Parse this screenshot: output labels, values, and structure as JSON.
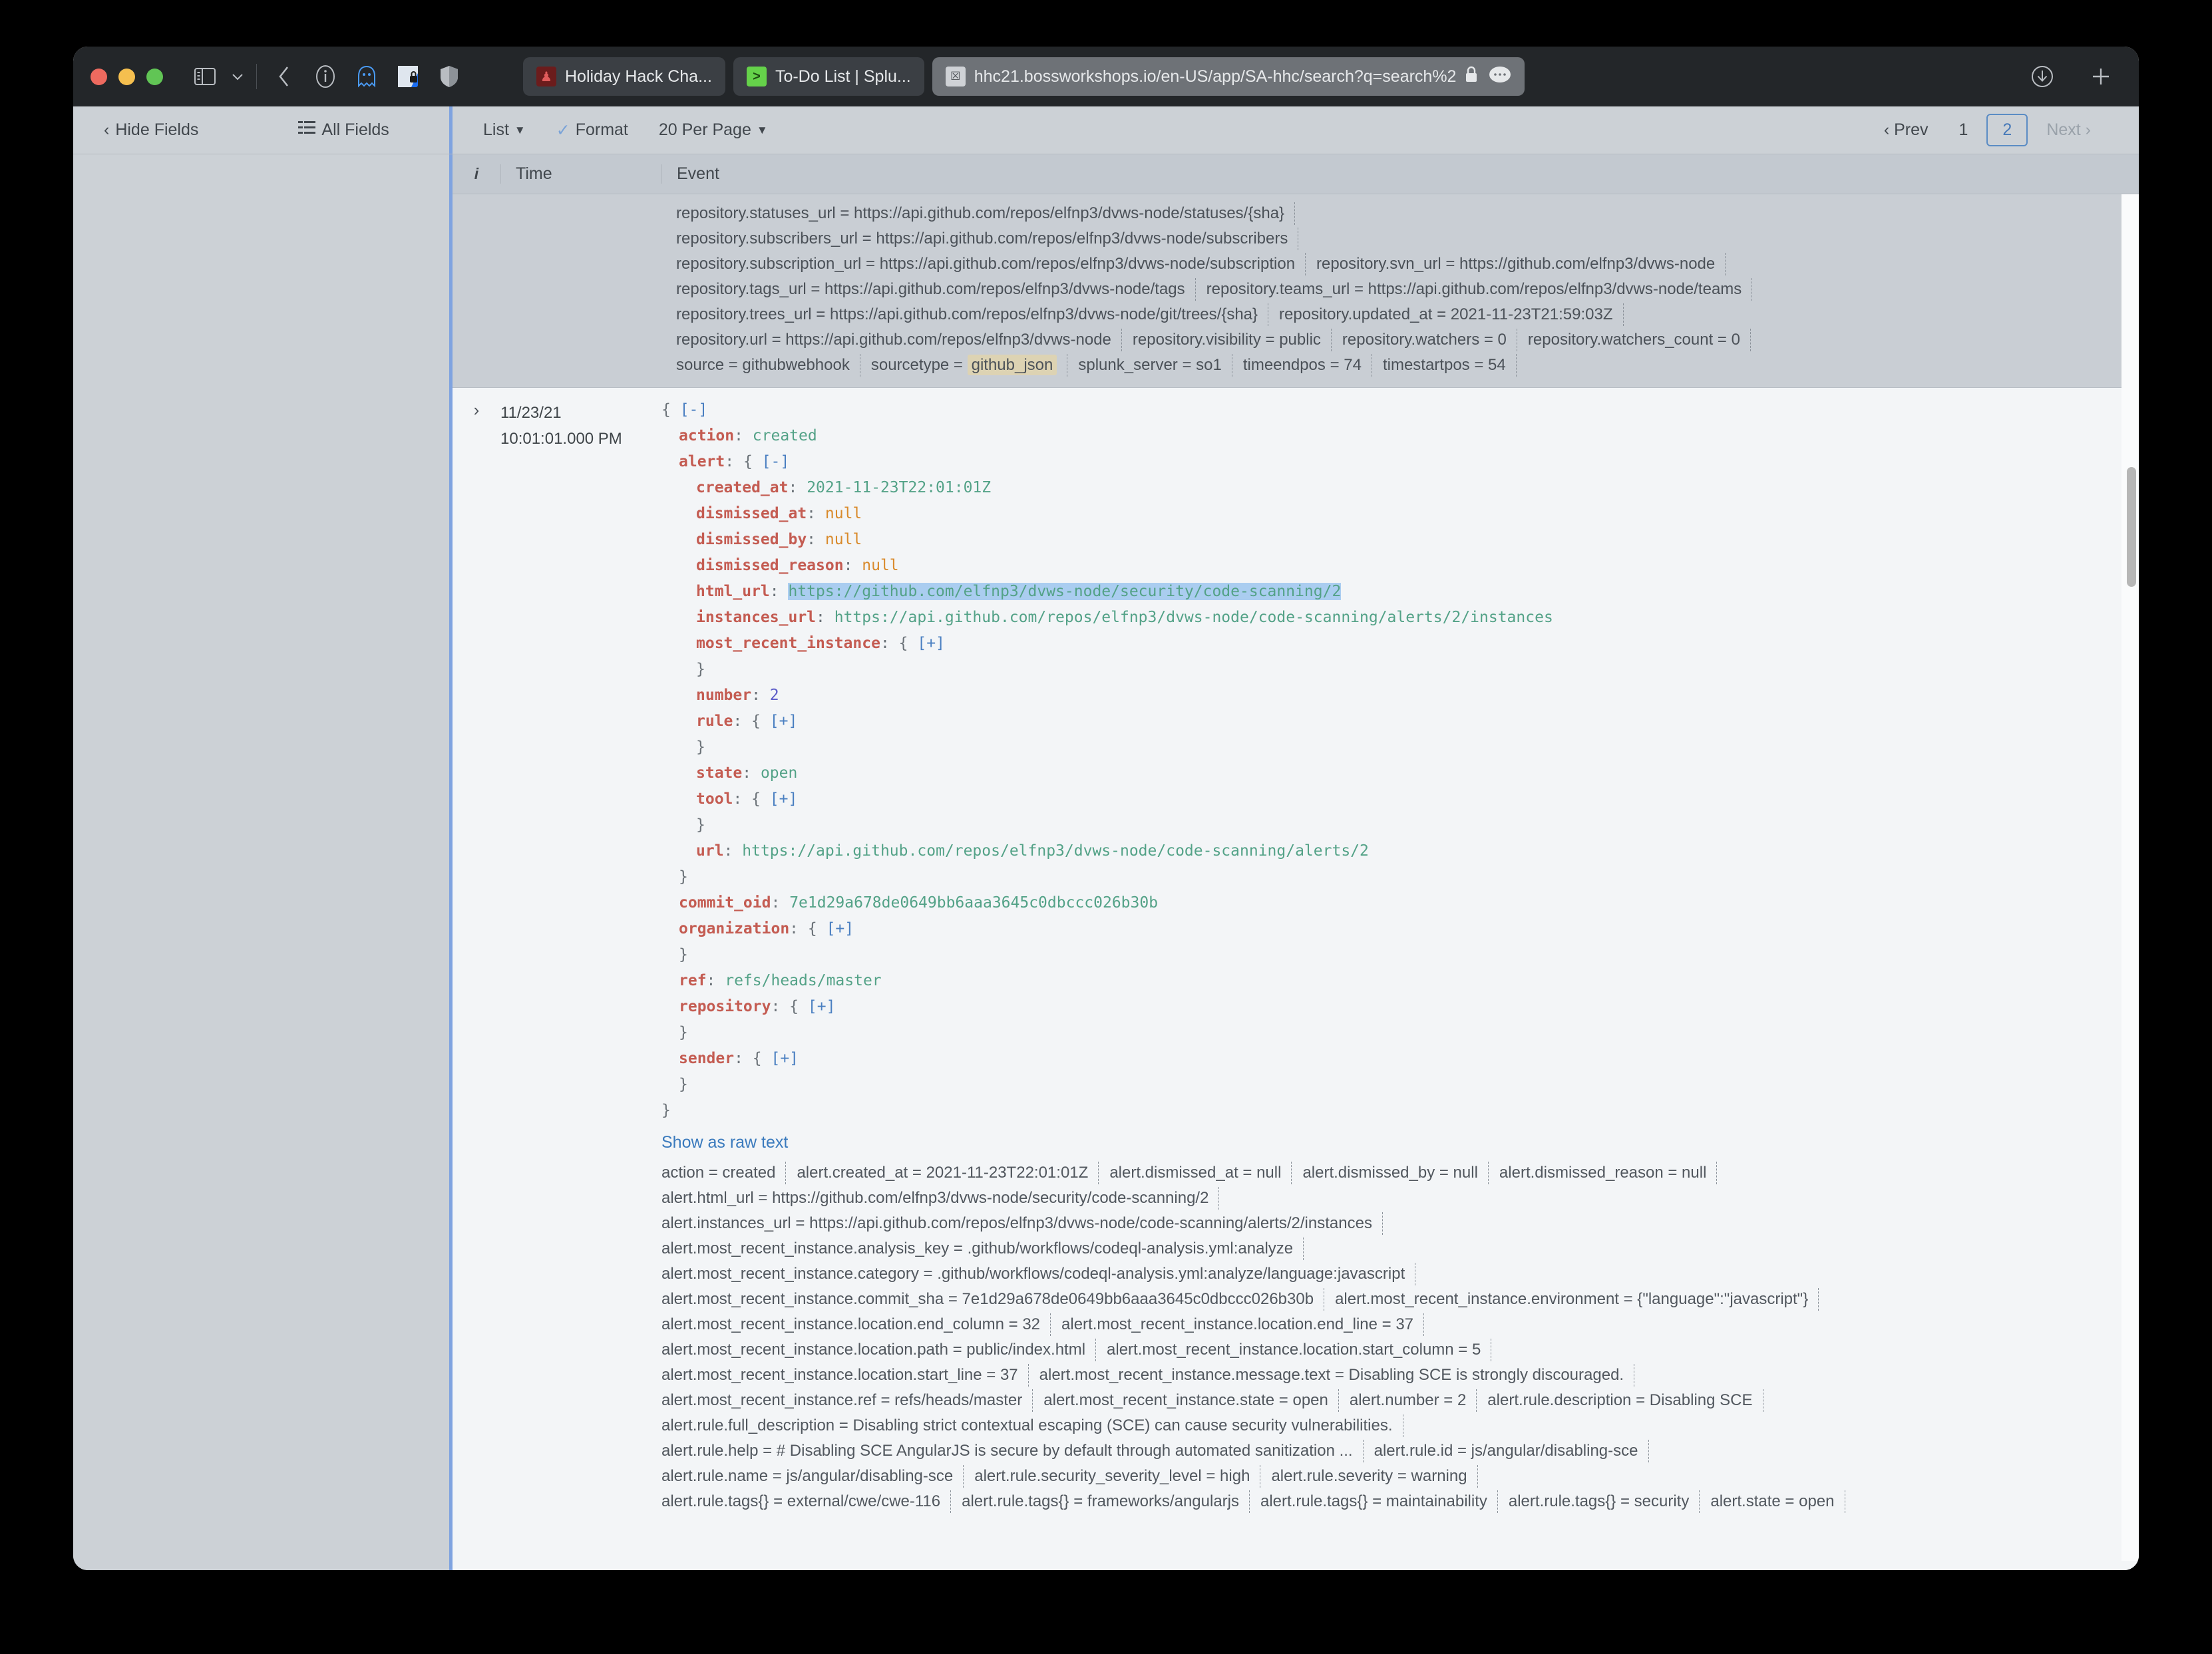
{
  "browser": {
    "window_controls": [
      "close",
      "minimize",
      "zoom"
    ],
    "icons": [
      "sidebar-toggle-icon",
      "chevron-down-icon",
      "back-icon",
      "info-icon",
      "ghostery-icon",
      "privacy-badger-icon",
      "shield-icon",
      "download-icon",
      "new-tab-icon"
    ],
    "tabs": [
      {
        "title": "Holiday Hack Cha...",
        "favicon": "hhc-favicon",
        "active": false
      },
      {
        "title": "To-Do List | Splu...",
        "favicon": "splunk-favicon",
        "active": false
      },
      {
        "title": "hhc21.bossworkshops.io/en-US/app/SA-hhc/search?q=search%2",
        "favicon": "x-favicon",
        "active": true
      }
    ],
    "address_lock": "lock-icon",
    "address_menu": "more-icon"
  },
  "toolbar": {
    "hide_fields": "Hide Fields",
    "all_fields": "All Fields",
    "view_mode": "List",
    "format": "Format",
    "per_page": "20 Per Page",
    "pager": {
      "prev": "Prev",
      "pages": [
        "1",
        "2"
      ],
      "current": "2",
      "next": "Next"
    }
  },
  "table": {
    "headers": {
      "info": "i",
      "time": "Time",
      "event": "Event"
    }
  },
  "previous_event_fields": [
    [
      {
        "text": "repository.statuses_url = https://api.github.com/repos/elfnp3/dvws-node/statuses/{sha}"
      }
    ],
    [
      {
        "text": "repository.subscribers_url = https://api.github.com/repos/elfnp3/dvws-node/subscribers"
      }
    ],
    [
      {
        "text": "repository.subscription_url = https://api.github.com/repos/elfnp3/dvws-node/subscription"
      },
      {
        "text": "repository.svn_url = https://github.com/elfnp3/dvws-node"
      }
    ],
    [
      {
        "text": "repository.tags_url = https://api.github.com/repos/elfnp3/dvws-node/tags"
      },
      {
        "text": "repository.teams_url = https://api.github.com/repos/elfnp3/dvws-node/teams"
      }
    ],
    [
      {
        "text": "repository.trees_url = https://api.github.com/repos/elfnp3/dvws-node/git/trees/{sha}"
      },
      {
        "text": "repository.updated_at = 2021-11-23T21:59:03Z"
      }
    ],
    [
      {
        "text": "repository.url = https://api.github.com/repos/elfnp3/dvws-node"
      },
      {
        "text": "repository.visibility = public"
      },
      {
        "text": "repository.watchers = 0"
      },
      {
        "text": "repository.watchers_count = 0"
      }
    ],
    [
      {
        "text": "source = githubwebhook"
      },
      {
        "text": "sourcetype = ",
        "highlight": "github_json"
      },
      {
        "text": "splunk_server = so1"
      },
      {
        "text": "timeendpos = 74"
      },
      {
        "text": "timestartpos = 54"
      }
    ]
  ],
  "event": {
    "expander": "›",
    "date": "11/23/21",
    "time": "10:01:01.000 PM",
    "json_lines": [
      {
        "indent": 0,
        "parts": [
          {
            "t": "{ ",
            "c": "p"
          },
          {
            "t": "[-]",
            "c": "br"
          }
        ]
      },
      {
        "indent": 1,
        "parts": [
          {
            "t": "action",
            "c": "k"
          },
          {
            "t": ": ",
            "c": "p"
          },
          {
            "t": "created",
            "c": "s"
          }
        ]
      },
      {
        "indent": 1,
        "parts": [
          {
            "t": "alert",
            "c": "k"
          },
          {
            "t": ": { ",
            "c": "p"
          },
          {
            "t": "[-]",
            "c": "br"
          }
        ]
      },
      {
        "indent": 2,
        "parts": [
          {
            "t": "created_at",
            "c": "k"
          },
          {
            "t": ": ",
            "c": "p"
          },
          {
            "t": "2021-11-23T22:01:01Z",
            "c": "s"
          }
        ]
      },
      {
        "indent": 2,
        "parts": [
          {
            "t": "dismissed_at",
            "c": "k"
          },
          {
            "t": ": ",
            "c": "p"
          },
          {
            "t": "null",
            "c": "nul"
          }
        ]
      },
      {
        "indent": 2,
        "parts": [
          {
            "t": "dismissed_by",
            "c": "k"
          },
          {
            "t": ": ",
            "c": "p"
          },
          {
            "t": "null",
            "c": "nul"
          }
        ]
      },
      {
        "indent": 2,
        "parts": [
          {
            "t": "dismissed_reason",
            "c": "k"
          },
          {
            "t": ": ",
            "c": "p"
          },
          {
            "t": "null",
            "c": "nul"
          }
        ]
      },
      {
        "indent": 2,
        "parts": [
          {
            "t": "html_url",
            "c": "k"
          },
          {
            "t": ": ",
            "c": "p"
          },
          {
            "t": "https://github.com/elfnp3/dvws-node/security/code-scanning/2",
            "c": "s",
            "sel": true
          }
        ]
      },
      {
        "indent": 2,
        "parts": [
          {
            "t": "instances_url",
            "c": "k"
          },
          {
            "t": ": ",
            "c": "p"
          },
          {
            "t": "https://api.github.com/repos/elfnp3/dvws-node/code-scanning/alerts/2/instances",
            "c": "s"
          }
        ]
      },
      {
        "indent": 2,
        "parts": [
          {
            "t": "most_recent_instance",
            "c": "k"
          },
          {
            "t": ": { ",
            "c": "p"
          },
          {
            "t": "[+]",
            "c": "br"
          }
        ]
      },
      {
        "indent": 2,
        "parts": [
          {
            "t": "}",
            "c": "p"
          }
        ]
      },
      {
        "indent": 2,
        "parts": [
          {
            "t": "number",
            "c": "k"
          },
          {
            "t": ": ",
            "c": "p"
          },
          {
            "t": "2",
            "c": "n"
          }
        ]
      },
      {
        "indent": 2,
        "parts": [
          {
            "t": "rule",
            "c": "k"
          },
          {
            "t": ": { ",
            "c": "p"
          },
          {
            "t": "[+]",
            "c": "br"
          }
        ]
      },
      {
        "indent": 2,
        "parts": [
          {
            "t": "}",
            "c": "p"
          }
        ]
      },
      {
        "indent": 2,
        "parts": [
          {
            "t": "state",
            "c": "k"
          },
          {
            "t": ": ",
            "c": "p"
          },
          {
            "t": "open",
            "c": "s"
          }
        ]
      },
      {
        "indent": 2,
        "parts": [
          {
            "t": "tool",
            "c": "k"
          },
          {
            "t": ": { ",
            "c": "p"
          },
          {
            "t": "[+]",
            "c": "br"
          }
        ]
      },
      {
        "indent": 2,
        "parts": [
          {
            "t": "}",
            "c": "p"
          }
        ]
      },
      {
        "indent": 2,
        "parts": [
          {
            "t": "url",
            "c": "k"
          },
          {
            "t": ": ",
            "c": "p"
          },
          {
            "t": "https://api.github.com/repos/elfnp3/dvws-node/code-scanning/alerts/2",
            "c": "s"
          }
        ]
      },
      {
        "indent": 1,
        "parts": [
          {
            "t": "}",
            "c": "p"
          }
        ]
      },
      {
        "indent": 1,
        "parts": [
          {
            "t": "commit_oid",
            "c": "k"
          },
          {
            "t": ": ",
            "c": "p"
          },
          {
            "t": "7e1d29a678de0649bb6aaa3645c0dbccc026b30b",
            "c": "s"
          }
        ]
      },
      {
        "indent": 1,
        "parts": [
          {
            "t": "organization",
            "c": "k"
          },
          {
            "t": ": { ",
            "c": "p"
          },
          {
            "t": "[+]",
            "c": "br"
          }
        ]
      },
      {
        "indent": 1,
        "parts": [
          {
            "t": "}",
            "c": "p"
          }
        ]
      },
      {
        "indent": 1,
        "parts": [
          {
            "t": "ref",
            "c": "k"
          },
          {
            "t": ": ",
            "c": "p"
          },
          {
            "t": "refs/heads/master",
            "c": "s"
          }
        ]
      },
      {
        "indent": 1,
        "parts": [
          {
            "t": "repository",
            "c": "k"
          },
          {
            "t": ": { ",
            "c": "p"
          },
          {
            "t": "[+]",
            "c": "br"
          }
        ]
      },
      {
        "indent": 1,
        "parts": [
          {
            "t": "}",
            "c": "p"
          }
        ]
      },
      {
        "indent": 1,
        "parts": [
          {
            "t": "sender",
            "c": "k"
          },
          {
            "t": ": { ",
            "c": "p"
          },
          {
            "t": "[+]",
            "c": "br"
          }
        ]
      },
      {
        "indent": 1,
        "parts": [
          {
            "t": "}",
            "c": "p"
          }
        ]
      },
      {
        "indent": 0,
        "parts": [
          {
            "t": "}",
            "c": "p"
          }
        ]
      }
    ],
    "raw_text_link": "Show as raw text",
    "fields": [
      [
        {
          "text": "action = created"
        },
        {
          "text": "alert.created_at = 2021-11-23T22:01:01Z"
        },
        {
          "text": "alert.dismissed_at = null"
        },
        {
          "text": "alert.dismissed_by = null"
        },
        {
          "text": "alert.dismissed_reason = null"
        }
      ],
      [
        {
          "text": "alert.html_url = https://github.com/elfnp3/dvws-node/security/code-scanning/2"
        }
      ],
      [
        {
          "text": "alert.instances_url = https://api.github.com/repos/elfnp3/dvws-node/code-scanning/alerts/2/instances"
        }
      ],
      [
        {
          "text": "alert.most_recent_instance.analysis_key = .github/workflows/codeql-analysis.yml:analyze"
        }
      ],
      [
        {
          "text": "alert.most_recent_instance.category = .github/workflows/codeql-analysis.yml:analyze/language:javascript"
        }
      ],
      [
        {
          "text": "alert.most_recent_instance.commit_sha = 7e1d29a678de0649bb6aaa3645c0dbccc026b30b"
        },
        {
          "text": "alert.most_recent_instance.environment = {\"language\":\"javascript\"}"
        }
      ],
      [
        {
          "text": "alert.most_recent_instance.location.end_column = 32"
        },
        {
          "text": "alert.most_recent_instance.location.end_line = 37"
        }
      ],
      [
        {
          "text": "alert.most_recent_instance.location.path = public/index.html"
        },
        {
          "text": "alert.most_recent_instance.location.start_column = 5"
        }
      ],
      [
        {
          "text": "alert.most_recent_instance.location.start_line = 37"
        },
        {
          "text": "alert.most_recent_instance.message.text = Disabling SCE is strongly discouraged."
        }
      ],
      [
        {
          "text": "alert.most_recent_instance.ref = refs/heads/master"
        },
        {
          "text": "alert.most_recent_instance.state = open"
        },
        {
          "text": "alert.number = 2"
        },
        {
          "text": "alert.rule.description = Disabling SCE"
        }
      ],
      [
        {
          "text": "alert.rule.full_description = Disabling strict contextual escaping (SCE) can cause security vulnerabilities."
        }
      ],
      [
        {
          "text": "alert.rule.help = # Disabling SCE AngularJS is secure by default through automated sanitization ..."
        },
        {
          "text": "alert.rule.id = js/angular/disabling-sce"
        }
      ],
      [
        {
          "text": "alert.rule.name = js/angular/disabling-sce"
        },
        {
          "text": "alert.rule.security_severity_level = high"
        },
        {
          "text": "alert.rule.severity = warning"
        }
      ],
      [
        {
          "text": "alert.rule.tags{} = external/cwe/cwe-116"
        },
        {
          "text": "alert.rule.tags{} = frameworks/angularjs"
        },
        {
          "text": "alert.rule.tags{} = maintainability"
        },
        {
          "text": "alert.rule.tags{} = security"
        },
        {
          "text": "alert.state = open"
        }
      ]
    ]
  },
  "colors": {
    "chrome_bg": "#232629",
    "toolbar_bg": "#ccd1d6",
    "content_bg": "#f3f5f7",
    "accent_blue": "#7fa3e0",
    "json_key": "#c45c52",
    "json_string": "#53a287",
    "selection": "#aacdf0",
    "highlight": "#ddd3b3",
    "link": "#3a7abd"
  }
}
